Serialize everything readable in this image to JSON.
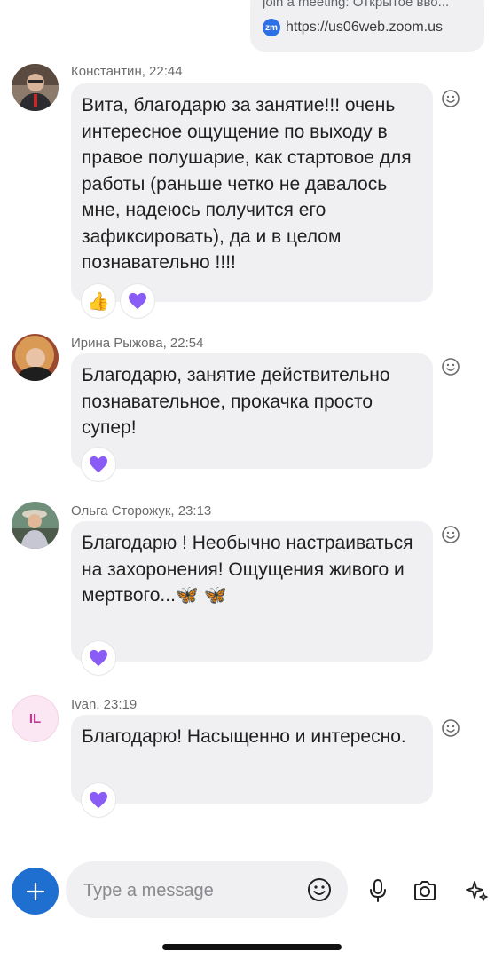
{
  "top_message": {
    "text": "join a meeting: Открытое вво...",
    "link_icon": "zm",
    "link": "https://us06web.zoom.us"
  },
  "messages": [
    {
      "sender": "Константин, 22:44",
      "text": "Вита, благодарю за занятие!!! очень интересное ощущение по выходу в правое полушарие, как стартовое для работы (раньше четко не давалось мне, надеюсь получится его зафиксировать), да и в целом познавательно !!!!",
      "reactions": [
        "👍",
        "💜"
      ],
      "avatar": "photo"
    },
    {
      "sender": "Ирина Рыжова, 22:54",
      "text": "Благодарю, занятие действительно познавательное, прокачка просто супер!",
      "reactions": [
        "💜"
      ],
      "avatar": "photo"
    },
    {
      "sender": "Ольга Сторожук, 23:13",
      "text": "Благодарю ! Необычно настраиваться на захоронения! Ощущения живого и мертвого...🦋 🦋",
      "reactions": [
        "💜"
      ],
      "avatar": "photo"
    },
    {
      "sender": "Ivan, 23:19",
      "text": "Благодарю! Насыщенно и интересно.",
      "reactions": [
        "💜"
      ],
      "avatar": "IL"
    }
  ],
  "composer": {
    "placeholder": "Type a message",
    "plus_icon": "plus-icon",
    "emoji_icon": "smiley-icon",
    "mic_icon": "microphone-icon",
    "camera_icon": "camera-icon",
    "ai_icon": "sparkle-icon"
  },
  "colors": {
    "bubble": "#f0f0f2",
    "accent": "#1f6fd1",
    "heart": "#8a5cf6",
    "initials_bg": "#fbe7f3",
    "initials_text": "#c03a93"
  }
}
